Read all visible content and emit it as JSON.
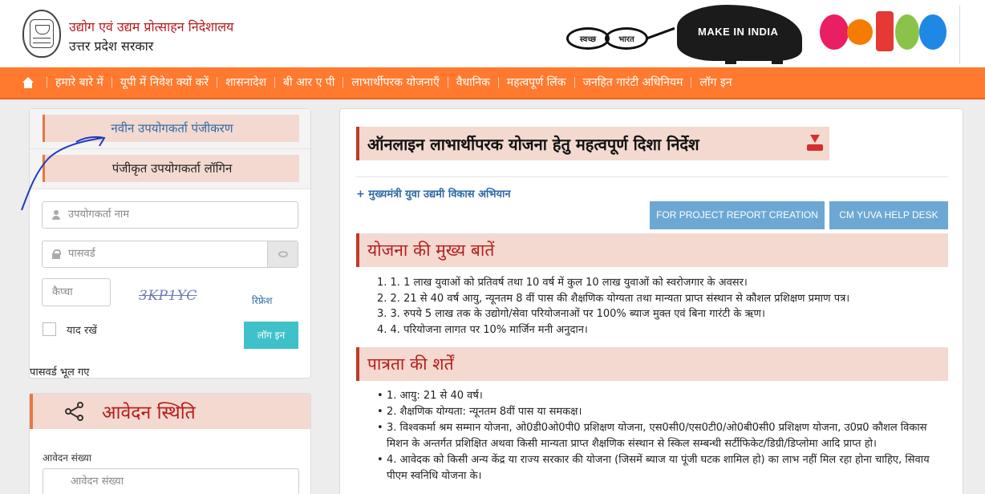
{
  "header": {
    "org_title": "उद्योग एवं उद्यम प्रोत्साहन निदेशालय",
    "org_subtitle": "उत्तर प्रदेश सरकार",
    "swachh_left": "स्वच्छ",
    "swachh_right": "भारत",
    "make_in_india": "MAKE IN INDIA"
  },
  "nav": {
    "items": [
      "हमारे बारे में",
      "यूपी में निवेश क्यों करें",
      "शासनादेश",
      "बी आर ए पी",
      "लाभार्थीपरक योजनाएँ",
      "वैधानिक",
      "महत्वपूर्ण लिंक",
      "जनहित गारंटी अधिनियम",
      "लॉग इन"
    ]
  },
  "login": {
    "tab_new": "नवीन उपयोगकर्ता पंजीकरण",
    "tab_registered": "पंजीकृत उपयोगकर्ता लॉगिन",
    "username_placeholder": "उपयोगकर्ता नाम",
    "password_placeholder": "पासवर्ड",
    "captcha_placeholder": "कैप्चा",
    "captcha_text": "3KP1YC",
    "refresh": "रिफ्रेश",
    "remember": "याद रखें",
    "login_button": "लॉग इन",
    "forgot": "पासवर्ड भूल गए"
  },
  "status": {
    "title": "आवेदन स्थिति",
    "app_label": "आवेदन संख्या",
    "app_placeholder": "आवेदन संख्या"
  },
  "main": {
    "title": "ऑनलाइन लाभार्थीपरक योजना हेतु महत्वपूर्ण दिशा निर्देश",
    "cm_link": "+ मुख्यमंत्री युवा उद्यमी विकास अभियान",
    "btn_report": "FOR PROJECT REPORT CREATION",
    "btn_helpdesk": "CM YUVA HELP DESK",
    "section1_title": "योजना की मुख्य बातें",
    "section1_items": [
      "1. 1. 1 लाख युवाओं को प्रतिवर्ष तथा 10 वर्ष में कुल 10 लाख युवाओं को स्वरोजगार के अवसर।",
      "2. 2. 21 से 40 वर्ष आयु, न्यूनतम 8 वीं पास की शैक्षणिक योग्यता तथा मान्यता प्राप्त संस्थान से कौशल प्रशिक्षण प्रमाण पत्र।",
      "3. 3. रुपये 5 लाख तक के उद्योगो/सेवा परियोजनाओं पर 100% ब्याज मुक्त एवं बिना गारंटी के ऋण।",
      "4. 4. परियोजना लागत पर 10% मार्जिन मनी अनुदान।"
    ],
    "section2_title": "पात्रता की शर्तें",
    "section2_items": [
      "1. आयु: 21 से 40 वर्ष।",
      "2. शैक्षणिक योग्यता: न्यूनतम 8वीं पास या समकक्ष।",
      "3. विश्वकर्मा श्रम सम्मान योजना, ओ0डी0ओ0पी0 प्रशिक्षण योजना, एस0सी0/एस0टी0/ओ0बी0सी0 प्रशिक्षण योजना, उ0प्र0 कौशल विकास मिशन के अन्तर्गत प्रशिक्षित अथवा किसी मान्यता प्राप्त शैक्षणिक संस्थान से स्किल सम्बन्धी सर्टीफिकेट/डिग्री/डिप्लोमा आदि प्राप्त हो।",
      "4. आवेदक को किसी अन्य केंद्र या राज्य सरकार की योजना (जिसमें ब्याज या पूंजी घटक शामिल हो) का लाभ नहीं मिल रहा होना चाहिए, सिवाय पीएम स्वनिधि योजना के।"
    ]
  },
  "colors": {
    "nav_bg": "#ff7a2f",
    "heading_red": "#b71c1c",
    "link_blue": "#2d6aa8",
    "button_blue": "#6ca8d3",
    "button_teal": "#3fc1c9",
    "section_bg": "#f3d9d0"
  },
  "icons": [
    "emblem-icon",
    "home-icon",
    "user-icon",
    "lock-icon",
    "eye-icon",
    "share-icon",
    "download-icon"
  ]
}
